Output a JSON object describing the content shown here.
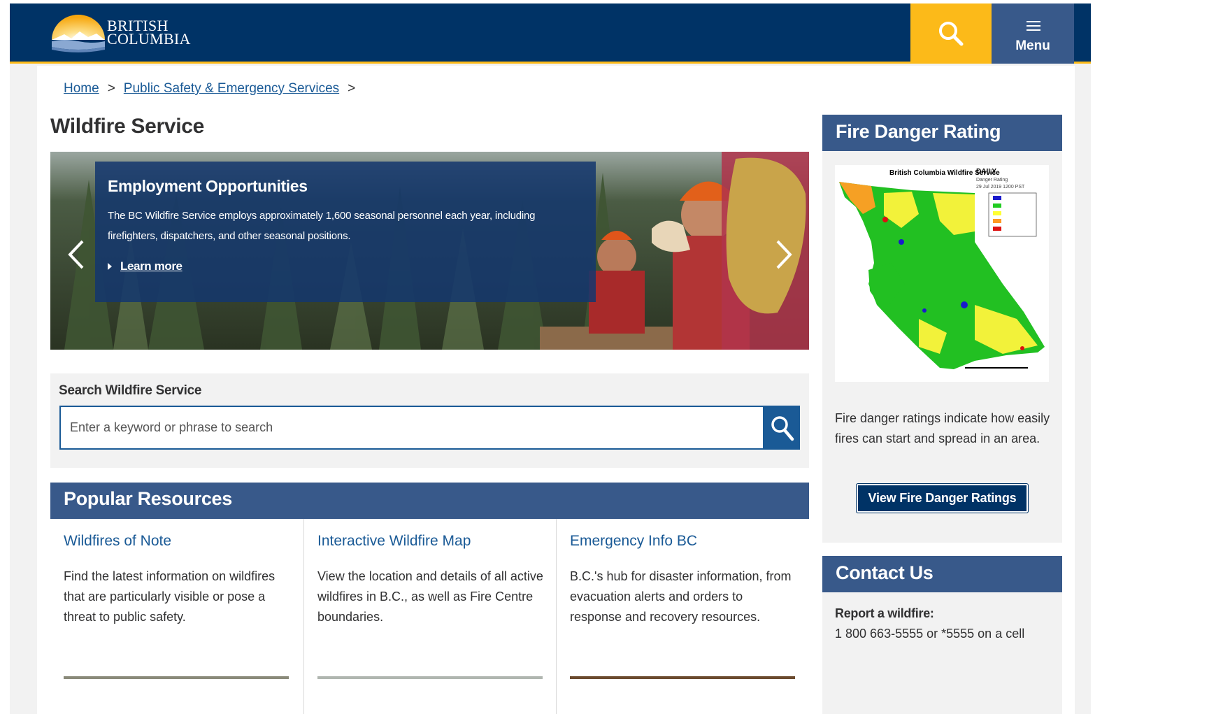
{
  "header": {
    "logo_line1": "BRITISH",
    "logo_line2": "COLUMBIA",
    "menu_label": "Menu"
  },
  "breadcrumb": {
    "home": "Home",
    "section": "Public Safety & Emergency Services",
    "separator": ">"
  },
  "page": {
    "title": "Wildfire Service"
  },
  "hero": {
    "title": "Employment Opportunities",
    "text": "The BC Wildfire Service employs approximately 1,600 seasonal personnel each year, including firefighters, dispatchers, and other seasonal positions.",
    "link": "Learn more"
  },
  "search": {
    "heading": "Search Wildfire Service",
    "placeholder": "Enter a keyword or phrase to search"
  },
  "popular": {
    "heading": "Popular Resources",
    "cards": [
      {
        "title": "Wildfires of Note",
        "text": "Find the latest information on wildfires that are particularly visible or pose a threat to public safety."
      },
      {
        "title": "Interactive Wildfire Map",
        "text": "View the location and details of all active wildfires in B.C., as well as Fire Centre boundaries."
      },
      {
        "title": "Emergency Info BC",
        "text": "B.C.'s hub for disaster information, from evacuation alerts and orders to response and recovery resources."
      }
    ]
  },
  "fire_danger": {
    "heading": "Fire Danger Rating",
    "map_title": "British Columbia Wildfire Service",
    "map_daily": "DAILY",
    "map_sub1": "Danger Rating",
    "map_sub2": "29 Jul 2019 1200 PST",
    "text": "Fire danger ratings indicate how easily fires can start and spread in an area.",
    "button": "View Fire Danger Ratings",
    "colors": {
      "very_low": "#1a1acc",
      "low": "#22cc22",
      "moderate": "#ffff33",
      "high": "#ff9922",
      "extreme": "#dd1111"
    }
  },
  "contact": {
    "heading": "Contact Us",
    "label": "Report a wildfire:",
    "phone": "1 800 663-5555 or *5555 on a cell"
  },
  "colors": {
    "brand_blue": "#003366",
    "brand_gold": "#fcba19",
    "panel_blue": "#38598a",
    "link_blue": "#1a5a96"
  }
}
